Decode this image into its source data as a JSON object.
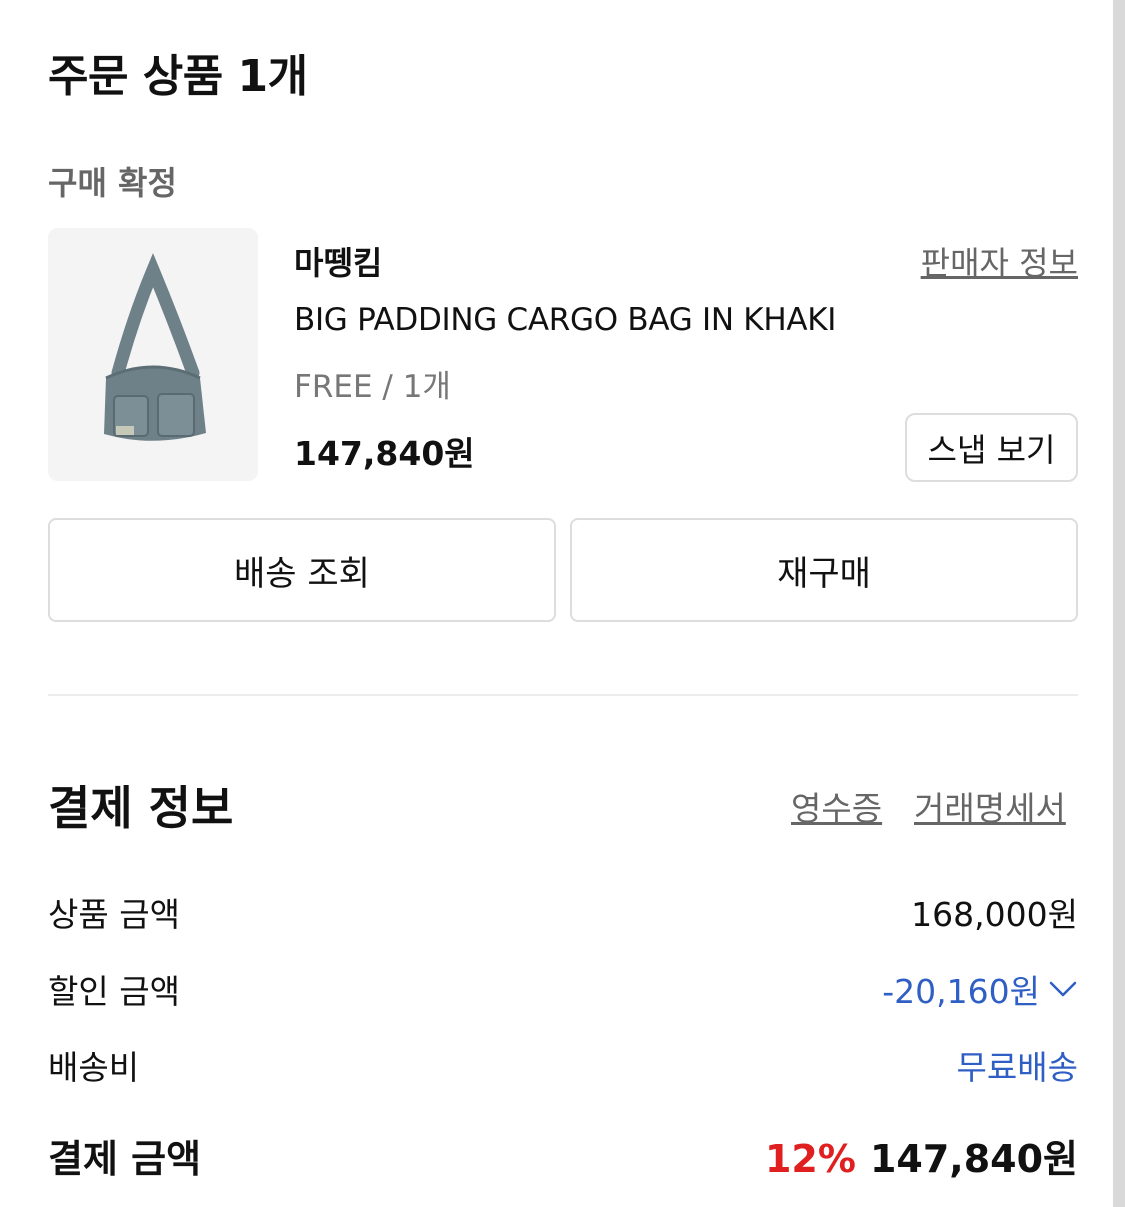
{
  "order": {
    "title": "주문 상품 1개",
    "status": "구매 확정"
  },
  "product": {
    "brand": "마뗑킴",
    "seller_info_link": "판매자 정보",
    "name": "BIG PADDING CARGO BAG IN KHAKI",
    "option": "FREE / 1개",
    "price": "147,840원",
    "snap_button": "스냅 보기"
  },
  "actions": {
    "delivery_track": "배송 조회",
    "rebuy": "재구매"
  },
  "payment": {
    "title": "결제 정보",
    "receipt_link": "영수증",
    "statement_link": "거래명세서",
    "rows": [
      {
        "label": "상품 금액",
        "value": "168,000원"
      },
      {
        "label": "할인 금액",
        "value": "-20,160원"
      },
      {
        "label": "배송비",
        "value": "무료배송"
      }
    ],
    "total_label": "결제 금액",
    "discount_rate": "12%",
    "total_value": "147,840원"
  },
  "icons": {
    "discount_toggle": "chevron-down-icon"
  },
  "colors": {
    "link_blue": "#2f5fc4",
    "discount_red": "#e02020",
    "muted_text": "#666666"
  }
}
